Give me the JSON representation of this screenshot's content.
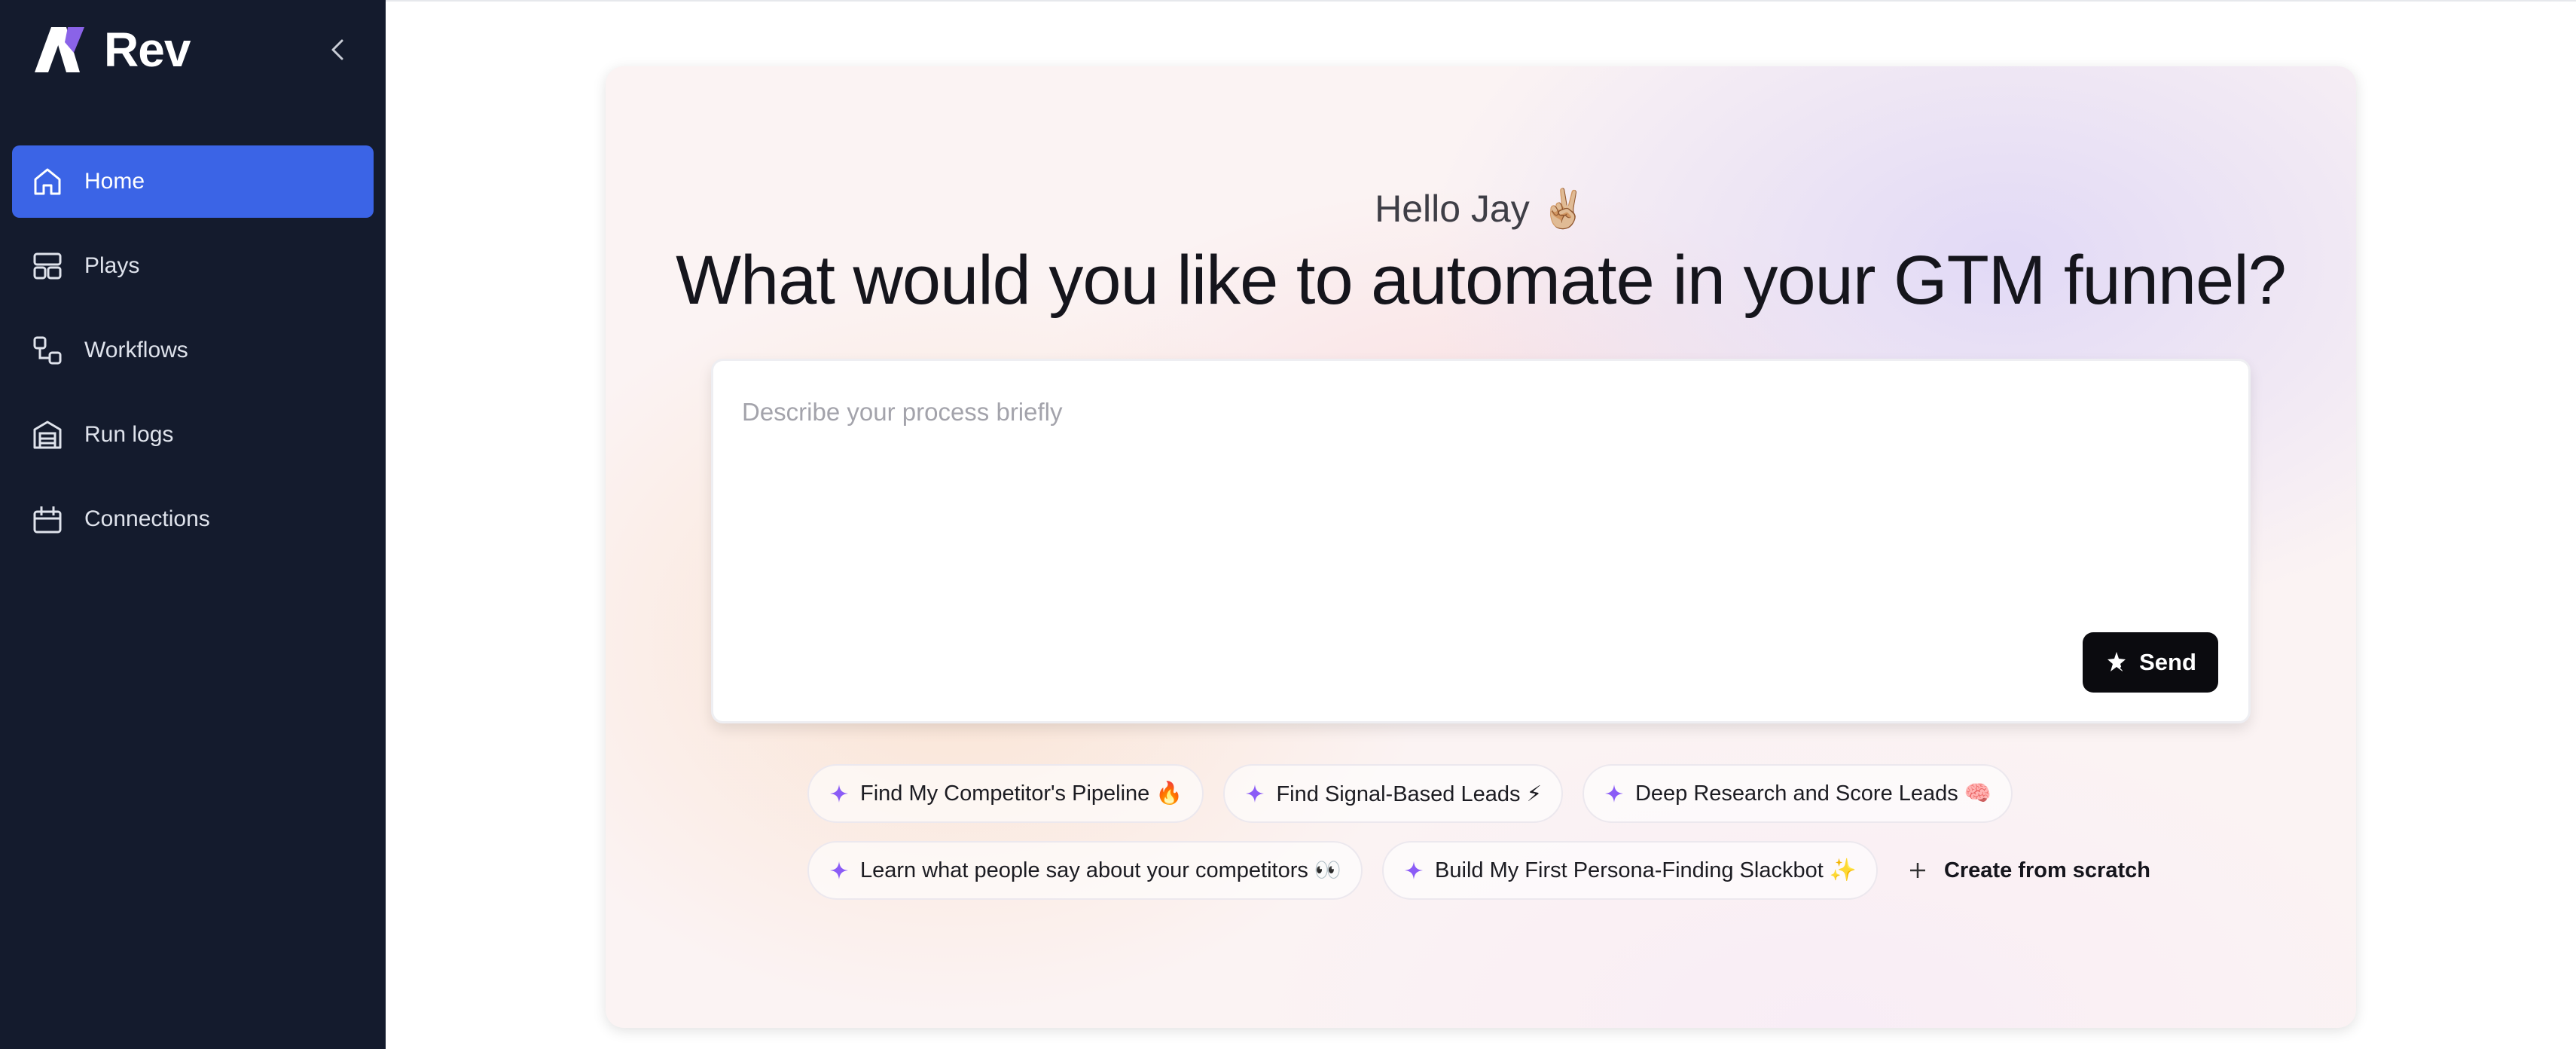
{
  "app": {
    "brand": "Rev"
  },
  "sidebar": {
    "items": [
      {
        "label": "Home",
        "icon": "home-icon",
        "active": true
      },
      {
        "label": "Plays",
        "icon": "layout-icon",
        "active": false
      },
      {
        "label": "Workflows",
        "icon": "workflow-icon",
        "active": false
      },
      {
        "label": "Run logs",
        "icon": "garage-icon",
        "active": false
      },
      {
        "label": "Connections",
        "icon": "connections-icon",
        "active": false
      }
    ]
  },
  "main": {
    "greeting": "Hello Jay ✌🏼",
    "headline": "What would you like to automate in your GTM funnel?",
    "prompt": {
      "placeholder": "Describe your process briefly",
      "value": ""
    },
    "send_label": "Send",
    "suggestions_row1": [
      {
        "label": "Find My Competitor's Pipeline 🔥"
      },
      {
        "label": "Find Signal-Based Leads ⚡"
      },
      {
        "label": "Deep Research and Score Leads 🧠"
      }
    ],
    "suggestions_row2": [
      {
        "label": "Learn what people say about your competitors 👀"
      },
      {
        "label": "Build My First Persona-Finding Slackbot ✨"
      }
    ],
    "create_label": "Create from scratch"
  },
  "colors": {
    "sidebar_bg": "#141b2d",
    "accent": "#3b64e6",
    "spark": "#8b5cf6",
    "send_bg": "#0b0b0f"
  }
}
